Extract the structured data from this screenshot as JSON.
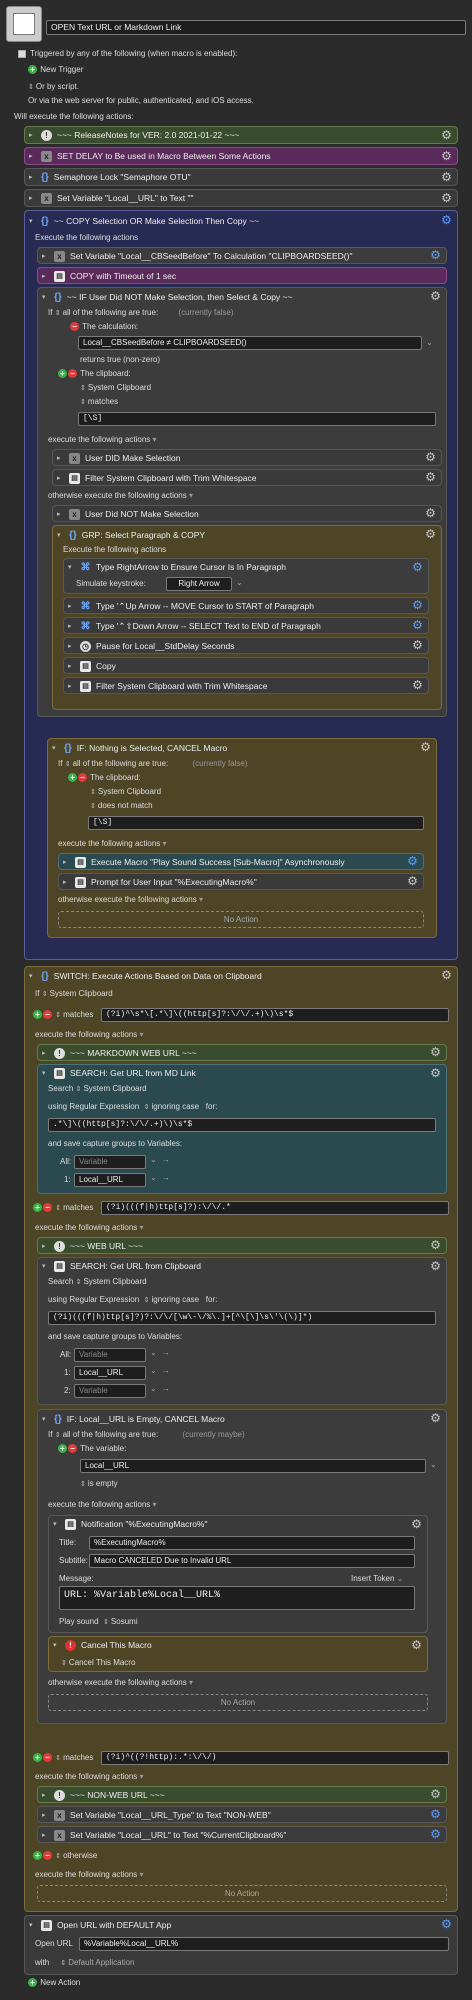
{
  "macro": {
    "title": "OPEN Text URL or Markdown Link",
    "trigger": "Triggered by any of the following (when macro is enabled):",
    "new_trigger": "New Trigger",
    "or_script": "Or by script.",
    "web_server": "Or via the web server for public, authenticated, and iOS access.",
    "will_execute": "Will execute the following actions:"
  },
  "top_actions": [
    "~~~ ReleaseNotes for  VER: 2.0    2021-01-22 ~~~",
    "SET DELAY to Be used in Macro Between Some Actions",
    "Semaphore Lock \"Semaphore OTU\"",
    "Set Variable \"Local__URL\" to Text \"\""
  ],
  "copy_group": {
    "title": "~~ COPY Selection OR Make Selection Then Copy ~~",
    "exec": "Execute the following actions",
    "set_var": "Set Variable \"Local__CBSeedBefore\" To Calculation \"CLIPBOARDSEED()\"",
    "copy_timeout": "COPY with Timeout of 1 sec"
  },
  "if1": {
    "title": "~~ IF User Did NOT Make Selection, then Select & Copy ~~",
    "if_all": "If",
    "all_true": "all of the following are true:",
    "status": "(currently false)",
    "calc_label": "The calculation:",
    "calc_value": "Local__CBSeedBefore ≠ CLIPBOARDSEED()",
    "returns": "returns true (non-zero)",
    "clip_label": "The clipboard:",
    "sys_clip": "System Clipboard",
    "matches": "matches",
    "regex": "[\\S]",
    "exec": "execute the following actions",
    "a1": "User DID Make Selection",
    "a2": "Filter System Clipboard with Trim Whitespace",
    "otherwise": "otherwise execute the following actions",
    "o1": "User Did NOT Make Selection"
  },
  "grp": {
    "title": "GRP:  Select Paragraph & COPY",
    "exec": "Execute the following actions",
    "type_right": "Type RightArrow to Ensure Cursor Is In Paragraph",
    "sim_key": "Simulate keystroke:",
    "sim_val": "Right Arrow",
    "up": "Type '⌃Up Arrow -- MOVE Cursor to START of Paragraph",
    "down": "Type '⌃⇧Down Arrow -- SELECT Text to END of Paragraph",
    "pause": "Pause for Local__StdDelay Seconds",
    "copy": "Copy",
    "filter": "Filter System Clipboard with Trim Whitespace"
  },
  "if2": {
    "title": "IF:  Nothing is Selected, CANCEL Macro",
    "if_all": "If",
    "all_true": "all of the following are true:",
    "status": "(currently false)",
    "clip_label": "The clipboard:",
    "sys_clip": "System Clipboard",
    "not_match": "does not match",
    "regex": "[\\S]",
    "exec": "execute the following actions",
    "a1": "Execute Macro \"Play Sound Success [Sub-Macro]\" Asynchronously",
    "a2": "Prompt for User Input \"%ExecutingMacro%\"",
    "otherwise": "otherwise execute the following actions",
    "no_action": "No Action"
  },
  "switch": {
    "title": "SWITCH:  Execute Actions Based on Data on Clipboard",
    "if": "If",
    "source": "System Clipboard",
    "matches": "matches",
    "case1": "(?i)^\\s*\\[.*\\]\\((http[s]?:\\/\\/.+)\\)\\s*$",
    "exec": "execute the following actions",
    "md_title": "~~~ MARKDOWN WEB URL ~~~",
    "search1": "SEARCH:  Get URL from MD Link",
    "search_label": "Search",
    "using": "using Regular Expression",
    "ignoring": "ignoring case",
    "for": "for:",
    "re1": ".*\\]\\((http[s]?:\\/\\/.+)\\)\\s*$",
    "save": "and save capture groups to Variables:",
    "all": "All:",
    "one": "1:",
    "two": "2:",
    "variable_ph": "Variable",
    "local_url": "Local__URL",
    "case2": "(?i)(((f|h)ttp[s]?):\\/\\/.*",
    "web_title": "~~~ WEB URL ~~~",
    "search2": "SEARCH:  Get URL from Clipboard",
    "re2": "(?i)(((f|h)ttp[s]?)?:\\/\\/[\\w\\-\\/%\\.]+[^\\[\\]\\s\\'\\(\\)]*)",
    "if3_title": "IF:  Local__URL is Empty, CANCEL Macro",
    "if3_status": "(currently maybe)",
    "variable_label": "The variable:",
    "is_empty": "is empty",
    "notif": "Notification \"%ExecutingMacro%\"",
    "title_lbl": "Title:",
    "title_val": "%ExecutingMacro%",
    "subtitle_lbl": "Subtitle:",
    "subtitle_val": "Macro CANCELED Due to Invalid URL",
    "message_lbl": "Message:",
    "insert_token": "Insert Token",
    "message_val": "URL: %Variable%Local__URL%",
    "play_sound": "Play sound",
    "sound": "Sosumi",
    "cancel": "Cancel This Macro",
    "cancel_opt": "Cancel This Macro",
    "case3": "(?i)^((?!http):.*:\\/\\/)",
    "nonweb_title": "~~~ NON-WEB URL ~~~",
    "set_type": "Set Variable \"Local__URL_Type\" to Text \"NON-WEB\"",
    "set_url": "Set Variable \"Local__URL\" to Text \"%CurrentClipboard%\"",
    "otherwise": "otherwise",
    "no_action": "No Action"
  },
  "open": {
    "title": "Open URL with DEFAULT App",
    "open_url": "Open URL",
    "url_val": "%Variable%Local__URL%",
    "with": "with",
    "app": "Default Application"
  },
  "new_action": "New Action",
  "icons": {
    "gear": "gear-icon",
    "x": "x-action-icon",
    "brace": "group-brace-icon"
  }
}
